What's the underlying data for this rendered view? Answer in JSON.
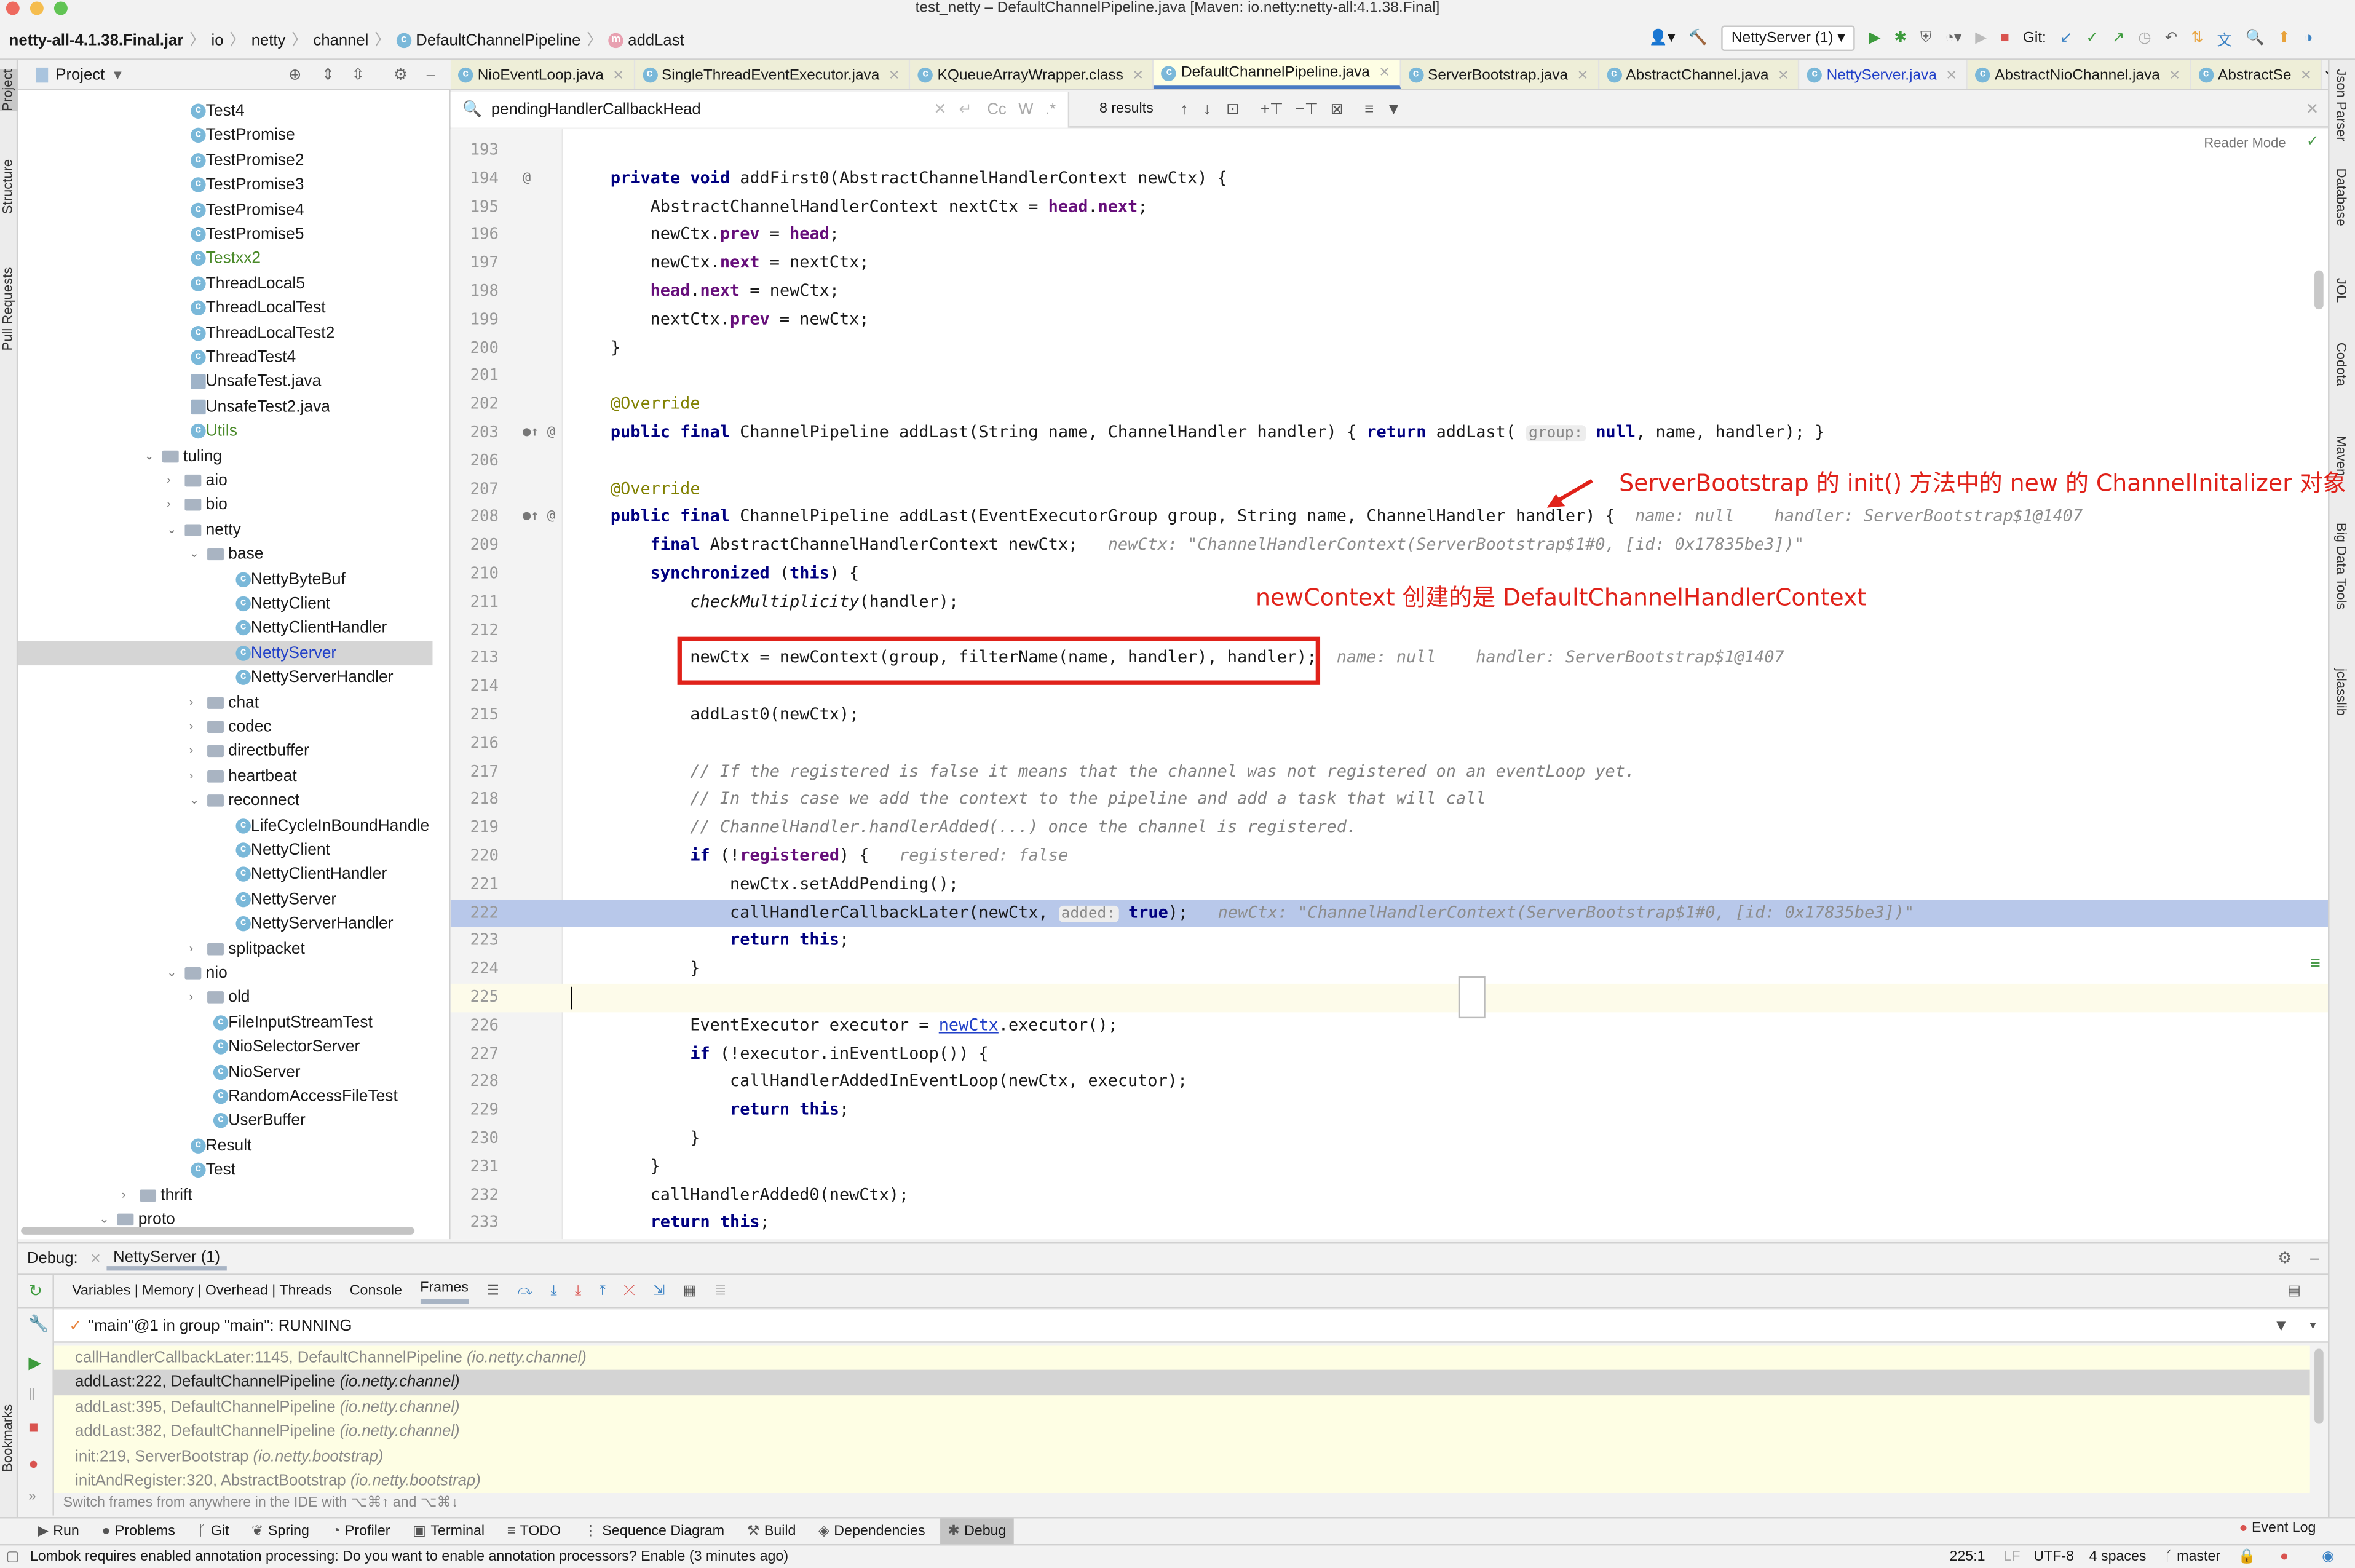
{
  "window": {
    "title": "test_netty – DefaultChannelPipeline.java [Maven: io.netty:netty-all:4.1.38.Final]"
  },
  "breadcrumb": [
    "netty-all-4.1.38.Final.jar",
    "io",
    "netty",
    "channel",
    "DefaultChannelPipeline",
    "addLast"
  ],
  "toolbar": {
    "run_config": "NettyServer (1)",
    "git_label": "Git:"
  },
  "left_strip": [
    "Project",
    "Structure",
    "Pull Requests",
    "Bookmarks"
  ],
  "right_strip": [
    "Json Parser",
    "Database",
    "JOL",
    "Codota",
    "Maven",
    "Big Data Tools",
    "jclasslib"
  ],
  "project": {
    "title": "Project",
    "tree": [
      {
        "label": "Test4",
        "level": 3,
        "type": "class"
      },
      {
        "label": "TestPromise",
        "level": 3,
        "type": "class"
      },
      {
        "label": "TestPromise2",
        "level": 3,
        "type": "class"
      },
      {
        "label": "TestPromise3",
        "level": 3,
        "type": "class"
      },
      {
        "label": "TestPromise4",
        "level": 3,
        "type": "class"
      },
      {
        "label": "TestPromise5",
        "level": 3,
        "type": "class"
      },
      {
        "label": "Testxx2",
        "level": 3,
        "type": "class",
        "color": "#4a8a2a"
      },
      {
        "label": "ThreadLocal5",
        "level": 3,
        "type": "class"
      },
      {
        "label": "ThreadLocalTest",
        "level": 3,
        "type": "class"
      },
      {
        "label": "ThreadLocalTest2",
        "level": 3,
        "type": "class"
      },
      {
        "label": "ThreadTest4",
        "level": 3,
        "type": "class"
      },
      {
        "label": "UnsafeTest.java",
        "level": 3,
        "type": "java"
      },
      {
        "label": "UnsafeTest2.java",
        "level": 3,
        "type": "java"
      },
      {
        "label": "Utils",
        "level": 3,
        "type": "class",
        "color": "#4a8a2a"
      },
      {
        "label": "tuling",
        "level": 2,
        "type": "folder",
        "expanded": true
      },
      {
        "label": "aio",
        "level": 3,
        "type": "folder"
      },
      {
        "label": "bio",
        "level": 3,
        "type": "folder"
      },
      {
        "label": "netty",
        "level": 3,
        "type": "folder",
        "expanded": true
      },
      {
        "label": "base",
        "level": 4,
        "type": "folder",
        "expanded": true
      },
      {
        "label": "NettyByteBuf",
        "level": 5,
        "type": "class"
      },
      {
        "label": "NettyClient",
        "level": 5,
        "type": "class"
      },
      {
        "label": "NettyClientHandler",
        "level": 5,
        "type": "class"
      },
      {
        "label": "NettyServer",
        "level": 5,
        "type": "class",
        "selected": true,
        "color": "#2241c8"
      },
      {
        "label": "NettyServerHandler",
        "level": 5,
        "type": "class"
      },
      {
        "label": "chat",
        "level": 4,
        "type": "folder"
      },
      {
        "label": "codec",
        "level": 4,
        "type": "folder"
      },
      {
        "label": "directbuffer",
        "level": 4,
        "type": "folder"
      },
      {
        "label": "heartbeat",
        "level": 4,
        "type": "folder"
      },
      {
        "label": "reconnect",
        "level": 4,
        "type": "folder",
        "expanded": true
      },
      {
        "label": "LifeCycleInBoundHandle",
        "level": 5,
        "type": "class"
      },
      {
        "label": "NettyClient",
        "level": 5,
        "type": "class"
      },
      {
        "label": "NettyClientHandler",
        "level": 5,
        "type": "class"
      },
      {
        "label": "NettyServer",
        "level": 5,
        "type": "class"
      },
      {
        "label": "NettyServerHandler",
        "level": 5,
        "type": "class"
      },
      {
        "label": "splitpacket",
        "level": 4,
        "type": "folder"
      },
      {
        "label": "nio",
        "level": 3,
        "type": "folder",
        "expanded": true
      },
      {
        "label": "old",
        "level": 4,
        "type": "folder"
      },
      {
        "label": "FileInputStreamTest",
        "level": 4,
        "type": "class"
      },
      {
        "label": "NioSelectorServer",
        "level": 4,
        "type": "class"
      },
      {
        "label": "NioServer",
        "level": 4,
        "type": "class"
      },
      {
        "label": "RandomAccessFileTest",
        "level": 4,
        "type": "class"
      },
      {
        "label": "UserBuffer",
        "level": 4,
        "type": "class"
      },
      {
        "label": "Result",
        "level": 3,
        "type": "class"
      },
      {
        "label": "Test",
        "level": 3,
        "type": "class"
      },
      {
        "label": "thrift",
        "level": 1,
        "type": "folder"
      },
      {
        "label": "proto",
        "level": 0,
        "type": "folder",
        "expanded": true
      }
    ]
  },
  "tabs": [
    {
      "label": "NioEventLoop.java"
    },
    {
      "label": "SingleThreadEventExecutor.java"
    },
    {
      "label": "KQueueArrayWrapper.class"
    },
    {
      "label": "DefaultChannelPipeline.java",
      "active": true
    },
    {
      "label": "ServerBootstrap.java"
    },
    {
      "label": "AbstractChannel.java"
    },
    {
      "label": "NettyServer.java",
      "plain": true,
      "color": "#2241c8"
    },
    {
      "label": "AbstractNioChannel.java"
    },
    {
      "label": "AbstractSe"
    }
  ],
  "search": {
    "value": "pendingHandlerCallbackHead",
    "match_case": "Cc",
    "words": "W",
    "results": "8 results"
  },
  "editor": {
    "reader_mode": "Reader Mode",
    "lines": [
      {
        "n": "193",
        "t": []
      },
      {
        "n": "194",
        "m": "@",
        "t": [
          [
            "    "
          ],
          [
            "private void ",
            "kw"
          ],
          [
            "addFirst0(AbstractChannelHandlerContext newCtx) {"
          ]
        ]
      },
      {
        "n": "195",
        "t": [
          [
            "        AbstractChannelHandlerContext nextCtx = "
          ],
          [
            "head",
            "fld"
          ],
          [
            "."
          ],
          [
            "next",
            "fld"
          ],
          [
            ";"
          ]
        ]
      },
      {
        "n": "196",
        "t": [
          [
            "        newCtx."
          ],
          [
            "prev",
            "fld"
          ],
          [
            " = "
          ],
          [
            "head",
            "fld"
          ],
          [
            ";"
          ]
        ]
      },
      {
        "n": "197",
        "t": [
          [
            "        newCtx."
          ],
          [
            "next",
            "fld"
          ],
          [
            " = nextCtx;"
          ]
        ]
      },
      {
        "n": "198",
        "t": [
          [
            "        "
          ],
          [
            "head",
            "fld"
          ],
          [
            "."
          ],
          [
            "next",
            "fld"
          ],
          [
            " = newCtx;"
          ]
        ]
      },
      {
        "n": "199",
        "t": [
          [
            "        nextCtx."
          ],
          [
            "prev",
            "fld"
          ],
          [
            " = newCtx;"
          ]
        ]
      },
      {
        "n": "200",
        "t": [
          [
            "    }"
          ]
        ]
      },
      {
        "n": "201",
        "t": []
      },
      {
        "n": "202",
        "t": [
          [
            "    "
          ],
          [
            "@Override",
            "an"
          ]
        ]
      },
      {
        "n": "203",
        "m": "●↑ @",
        "t": [
          [
            "    "
          ],
          [
            "public final ",
            "kw"
          ],
          [
            "ChannelPipeline addLast(String name, ChannelHandler handler) { "
          ],
          [
            "return ",
            "kw"
          ],
          [
            "addLast( "
          ],
          [
            "group:",
            "ph"
          ],
          [
            " "
          ],
          [
            "null",
            "kw"
          ],
          [
            ", name, handler); }"
          ]
        ]
      },
      {
        "n": "206",
        "t": []
      },
      {
        "n": "207",
        "t": [
          [
            "    "
          ],
          [
            "@Override",
            "an"
          ]
        ]
      },
      {
        "n": "208",
        "m": "●↑ @",
        "t": [
          [
            "    "
          ],
          [
            "public final ",
            "kw"
          ],
          [
            "ChannelPipeline addLast(EventExecutorGroup group, String name, ChannelHandler handler) {  "
          ],
          [
            "name: null    handler: ServerBootstrap$1@1407",
            "hint"
          ]
        ]
      },
      {
        "n": "209",
        "t": [
          [
            "        "
          ],
          [
            "final ",
            "kw"
          ],
          [
            "AbstractChannelHandlerContext newCtx;   "
          ],
          [
            "newCtx: \"ChannelHandlerContext(ServerBootstrap$1#0, [id: 0x17835be3])\"",
            "hint"
          ]
        ]
      },
      {
        "n": "210",
        "t": [
          [
            "        "
          ],
          [
            "synchronized ",
            "kw"
          ],
          [
            "("
          ],
          [
            "this",
            "kw"
          ],
          [
            ") {"
          ]
        ]
      },
      {
        "n": "211",
        "t": [
          [
            "            "
          ],
          [
            "checkMultiplicity",
            "it"
          ],
          [
            "(handler);"
          ]
        ]
      },
      {
        "n": "212",
        "t": []
      },
      {
        "n": "213",
        "t": [
          [
            "            newCtx = newContext(group, filterName(name, handler), handler);  "
          ],
          [
            "name: null    handler: ServerBootstrap$1@1407",
            "hint"
          ]
        ]
      },
      {
        "n": "214",
        "t": []
      },
      {
        "n": "215",
        "t": [
          [
            "            addLast0(newCtx);"
          ]
        ]
      },
      {
        "n": "216",
        "t": []
      },
      {
        "n": "217",
        "t": [
          [
            "            "
          ],
          [
            "// If the registered is false it means that the channel was not registered on an eventLoop yet.",
            "cm"
          ]
        ]
      },
      {
        "n": "218",
        "t": [
          [
            "            "
          ],
          [
            "// In this case we add the context to the pipeline and add a task that will call",
            "cm"
          ]
        ]
      },
      {
        "n": "219",
        "t": [
          [
            "            "
          ],
          [
            "// ChannelHandler.handlerAdded(...) once the channel is registered.",
            "cm"
          ]
        ]
      },
      {
        "n": "220",
        "t": [
          [
            "            "
          ],
          [
            "if ",
            "kw"
          ],
          [
            "(!"
          ],
          [
            "registered",
            "fld"
          ],
          [
            ") {   "
          ],
          [
            "registered: false",
            "hint"
          ]
        ]
      },
      {
        "n": "221",
        "t": [
          [
            "                newCtx.setAddPending();"
          ]
        ]
      },
      {
        "n": "222",
        "exec": true,
        "t": [
          [
            "                callHandlerCallbackLater(newCtx, "
          ],
          [
            "added:",
            "ph"
          ],
          [
            " "
          ],
          [
            "true",
            "kw"
          ],
          [
            ");   "
          ],
          [
            "newCtx: \"ChannelHandlerContext(ServerBootstrap$1#0, [id: 0x17835be3])\"",
            "hint"
          ]
        ]
      },
      {
        "n": "223",
        "t": [
          [
            "                "
          ],
          [
            "return this",
            "kw"
          ],
          [
            ";"
          ]
        ]
      },
      {
        "n": "224",
        "t": [
          [
            "            }"
          ]
        ]
      },
      {
        "n": "225",
        "cur": true,
        "t": []
      },
      {
        "n": "226",
        "t": [
          [
            "            EventExecutor executor = "
          ],
          [
            "newCtx",
            "lnk"
          ],
          [
            ".executor();"
          ]
        ]
      },
      {
        "n": "227",
        "t": [
          [
            "            "
          ],
          [
            "if ",
            "kw"
          ],
          [
            "(!executor.inEventLoop()) {"
          ]
        ]
      },
      {
        "n": "228",
        "t": [
          [
            "                callHandlerAddedInEventLoop(newCtx, executor);"
          ]
        ]
      },
      {
        "n": "229",
        "t": [
          [
            "                "
          ],
          [
            "return this",
            "kw"
          ],
          [
            ";"
          ]
        ]
      },
      {
        "n": "230",
        "t": [
          [
            "            }"
          ]
        ]
      },
      {
        "n": "231",
        "t": [
          [
            "        }"
          ]
        ]
      },
      {
        "n": "232",
        "t": [
          [
            "        callHandlerAdded0(newCtx);"
          ]
        ]
      },
      {
        "n": "233",
        "t": [
          [
            "        "
          ],
          [
            "return this",
            "kw"
          ],
          [
            ";"
          ]
        ]
      }
    ]
  },
  "annotations": {
    "note1": "ServerBootstrap 的 init() 方法中的 new 的 ChannelInitalizer 对象",
    "note2": "newContext 创建的是 DefaultChannelHandlerContext",
    "color": "#e0221a"
  },
  "debug": {
    "label": "Debug:",
    "session": "NettyServer (1)",
    "tabs": [
      "Variables | Memory | Overhead | Threads",
      "Console",
      "Frames"
    ],
    "thread": "\"main\"@1 in group \"main\": RUNNING",
    "frames": [
      {
        "m": "callHandlerCallbackLater:1145, DefaultChannelPipeline",
        "p": "(io.netty.channel)"
      },
      {
        "m": "addLast:222, DefaultChannelPipeline",
        "p": "(io.netty.channel)",
        "selected": true
      },
      {
        "m": "addLast:395, DefaultChannelPipeline",
        "p": "(io.netty.channel)"
      },
      {
        "m": "addLast:382, DefaultChannelPipeline",
        "p": "(io.netty.channel)"
      },
      {
        "m": "init:219, ServerBootstrap",
        "p": "(io.netty.bootstrap)"
      },
      {
        "m": "initAndRegister:320, AbstractBootstrap",
        "p": "(io.netty.bootstrap)"
      }
    ],
    "hint": "Switch frames from anywhere in the IDE with ⌥⌘↑ and ⌥⌘↓"
  },
  "bottom_tools": [
    {
      "label": "Run",
      "icon": "▶"
    },
    {
      "label": "Problems",
      "icon": "●"
    },
    {
      "label": "Git",
      "icon": "ᚴ"
    },
    {
      "label": "Spring",
      "icon": "❦"
    },
    {
      "label": "Profiler",
      "icon": "◔"
    },
    {
      "label": "Terminal",
      "icon": "▣"
    },
    {
      "label": "TODO",
      "icon": "≡"
    },
    {
      "label": "Sequence Diagram",
      "icon": "⋮"
    },
    {
      "label": "Build",
      "icon": "⚒"
    },
    {
      "label": "Dependencies",
      "icon": "◈"
    },
    {
      "label": "Debug",
      "icon": "✱",
      "active": true
    }
  ],
  "event_log": "Event Log",
  "status": {
    "message": "Lombok requires enabled annotation processing: Do you want to enable annotation processors? Enable (3 minutes ago)",
    "position": "225:1",
    "line_sep": "LF",
    "encoding": "UTF-8",
    "indent": "4 spaces",
    "branch": "master"
  }
}
